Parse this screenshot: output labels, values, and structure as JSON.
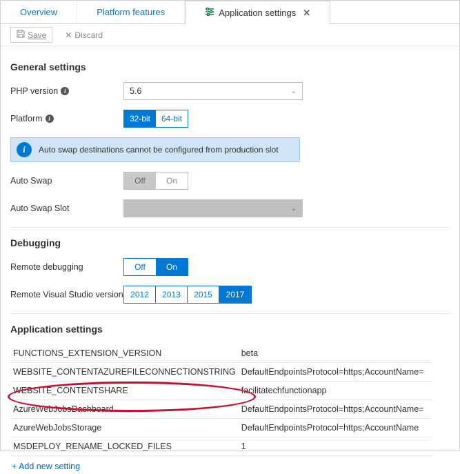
{
  "tabs": {
    "overview": "Overview",
    "platform": "Platform features",
    "appsettings": "Application settings"
  },
  "toolbar": {
    "save": "Save",
    "discard": "Discard"
  },
  "sections": {
    "general": "General settings",
    "debugging": "Debugging",
    "appsettings": "Application settings"
  },
  "labels": {
    "php_version": "PHP version",
    "platform": "Platform",
    "auto_swap": "Auto Swap",
    "auto_swap_slot": "Auto Swap Slot",
    "remote_debug": "Remote debugging",
    "remote_vs": "Remote Visual Studio version"
  },
  "values": {
    "php_version": "5.6",
    "platform_32": "32-bit",
    "platform_64": "64-bit",
    "on": "On",
    "off": "Off",
    "vs": [
      "2012",
      "2013",
      "2015",
      "2017"
    ]
  },
  "info_banner": "Auto swap destinations cannot be configured from production slot",
  "settings": [
    {
      "key": "FUNCTIONS_EXTENSION_VERSION",
      "value": "beta"
    },
    {
      "key": "WEBSITE_CONTENTAZUREFILECONNECTIONSTRING",
      "value": "DefaultEndpointsProtocol=https;AccountName="
    },
    {
      "key": "WEBSITE_CONTENTSHARE",
      "value": "facilitatechfunctionapp"
    },
    {
      "key": "AzureWebJobsDashboard",
      "value": "DefaultEndpointsProtocol=https;AccountName="
    },
    {
      "key": "AzureWebJobsStorage",
      "value": "DefaultEndpointsProtocol=https;AccountName"
    },
    {
      "key": "MSDEPLOY_RENAME_LOCKED_FILES",
      "value": "1"
    }
  ],
  "add_new": "+ Add new setting"
}
